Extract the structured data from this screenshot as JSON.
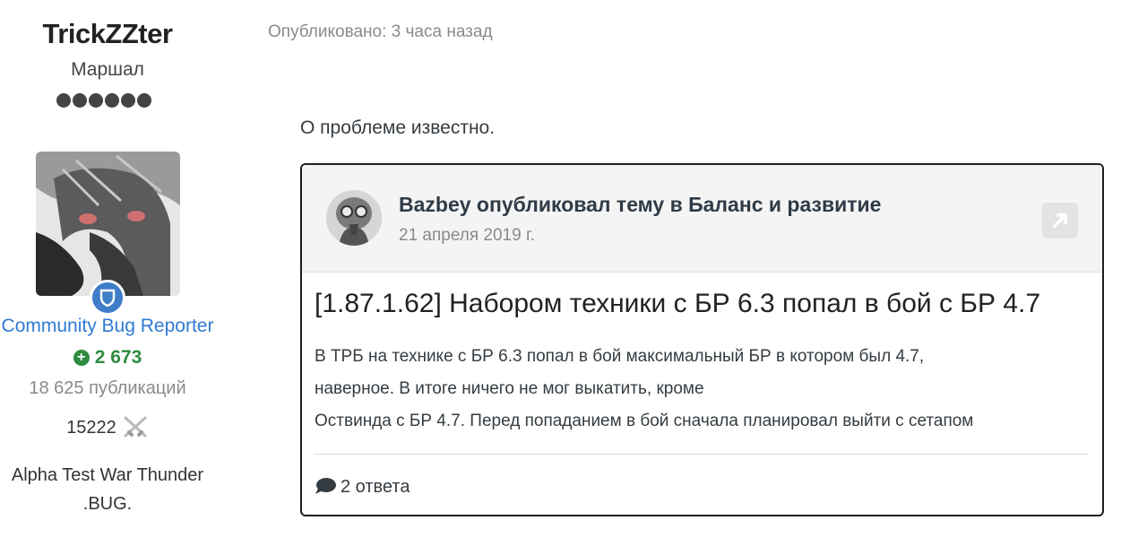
{
  "author": {
    "name": "TrickZZter",
    "rank": "Маршал",
    "pips": 6,
    "group": "Community Bug Reporter",
    "reputation": "2 673",
    "posts": "18 625 публикаций",
    "points": "15222",
    "custom_title_line1": "Alpha Test War Thunder",
    "custom_title_line2": ".BUG."
  },
  "post": {
    "meta": "Опубликовано: 3 часа назад",
    "text": "О проблеме известно."
  },
  "embed": {
    "author_line": "Bazbey опубликовал тему в Баланс и развитие",
    "date": "21 апреля 2019 г.",
    "title": "[1.87.1.62] Набором техники с БР 6.3 попал в бой с БР 4.7",
    "excerpt_line1": "В ТРБ на технике с БР 6.3 попал в бой максимальный БР в котором был 4.7,",
    "excerpt_line2": "наверное. В итоге ничего не мог выкатить, кроме",
    "excerpt_line3": "Оствинда с БР 4.7. Перед попаданием в бой сначала планировал выйти с сетапом",
    "replies": "2 ответа"
  },
  "icons": {
    "group_badge": "shield-icon",
    "reputation": "plus-circle-icon",
    "points": "crossed-swords-icon",
    "open_topic": "external-link-icon",
    "replies": "comment-bubble-icon"
  },
  "colors": {
    "group": "#2f7ad3",
    "reputation": "#2e8b3f",
    "badge": "#3f7dc9"
  }
}
